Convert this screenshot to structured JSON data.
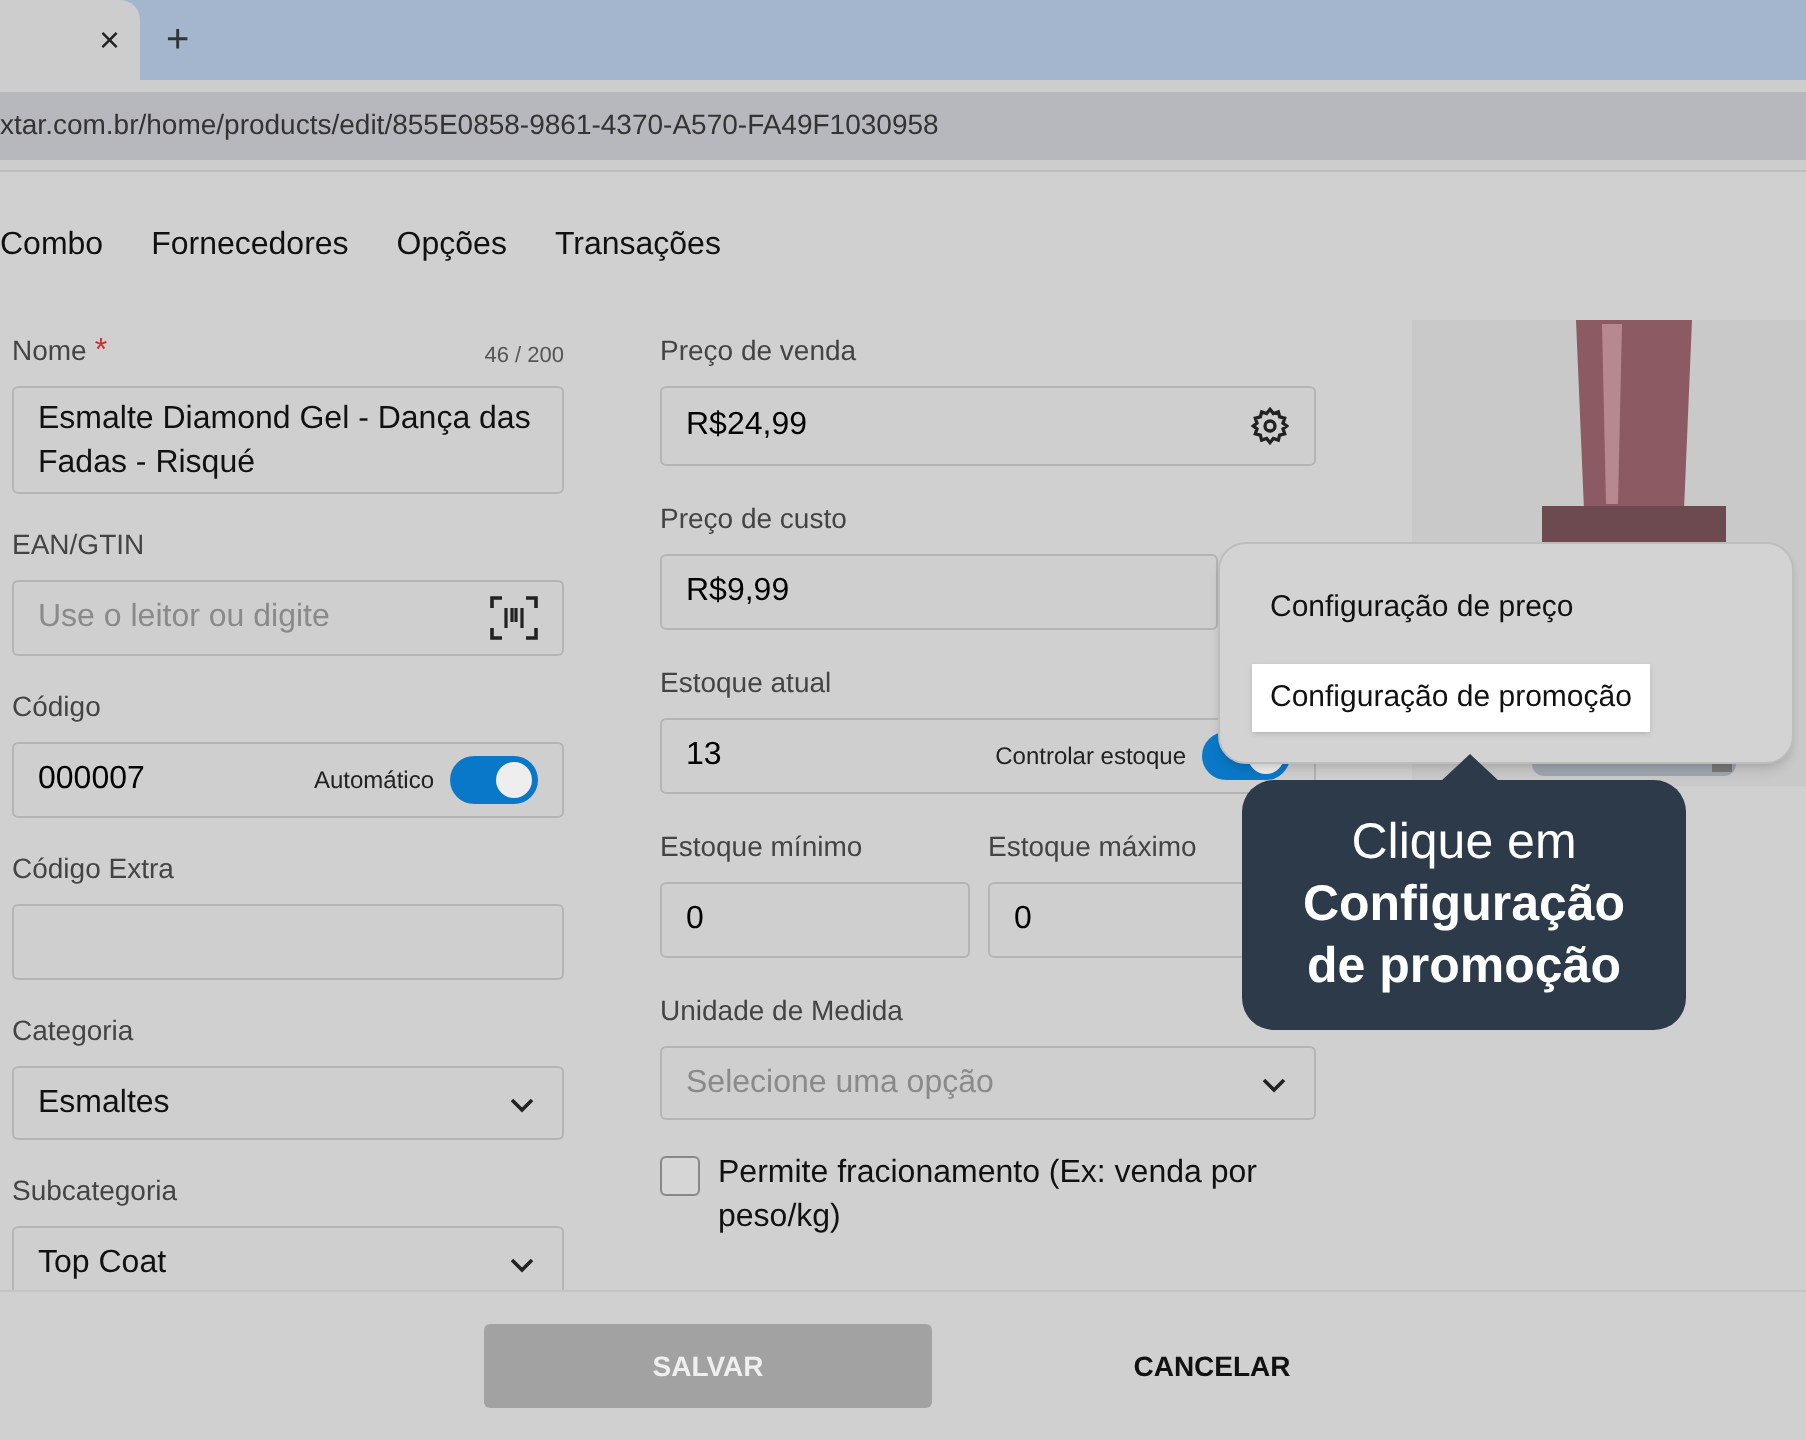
{
  "browser": {
    "tab_close": "×",
    "new_tab": "+",
    "url": "xtar.com.br/home/products/edit/855E0858-9861-4370-A570-FA49F1030958"
  },
  "nav_tabs": [
    {
      "label": "Combo"
    },
    {
      "label": "Fornecedores"
    },
    {
      "label": "Opções"
    },
    {
      "label": "Transações"
    }
  ],
  "left_fields": [
    {
      "kind": "textarea",
      "label": "Nome",
      "required_mark": "*",
      "counter": "46 / 200",
      "value": "Esmalte Diamond Gel - Dança das Fadas - Risqué"
    },
    {
      "kind": "scan",
      "label": "EAN/GTIN",
      "placeholder": "Use o leitor ou digite"
    },
    {
      "kind": "toggle",
      "label": "Código",
      "value": "000007",
      "toggle_label": "Automático",
      "on": true
    },
    {
      "kind": "text",
      "label": "Código Extra"
    },
    {
      "kind": "select",
      "label": "Categoria",
      "value": "Esmaltes"
    },
    {
      "kind": "select",
      "label": "Subcategoria",
      "value": "Top Coat"
    }
  ],
  "middle_fields": [
    {
      "kind": "gear",
      "label": "Preço de venda",
      "value": "R$24,99"
    },
    {
      "kind": "text",
      "label": "Preço de custo",
      "value": "R$9,99"
    },
    {
      "kind": "toggle",
      "label": "Estoque atual",
      "value": "13",
      "toggle_label": "Controlar estoque",
      "on": true
    },
    {
      "kind": "pair",
      "fields": [
        {
          "label": "Estoque mínimo",
          "value": "0"
        },
        {
          "label": "Estoque máximo",
          "value": "0"
        }
      ]
    },
    {
      "kind": "select",
      "label": "Unidade de Medida",
      "placeholder": "Selecione uma opção"
    },
    {
      "kind": "checkbox",
      "label": "Permite fracionamento (Ex: venda por peso/kg)",
      "checked": false
    }
  ],
  "menu": [
    {
      "label": "Configuração de preço",
      "selected": false
    },
    {
      "label": "Configuração de promoção",
      "selected": true
    }
  ],
  "tooltip": {
    "text": "Clique em **Configuração de promoção**"
  },
  "footer": {
    "buttons": [
      {
        "label": "SALVAR",
        "disabled": true
      },
      {
        "label": "CANCELAR",
        "disabled": false
      }
    ]
  }
}
